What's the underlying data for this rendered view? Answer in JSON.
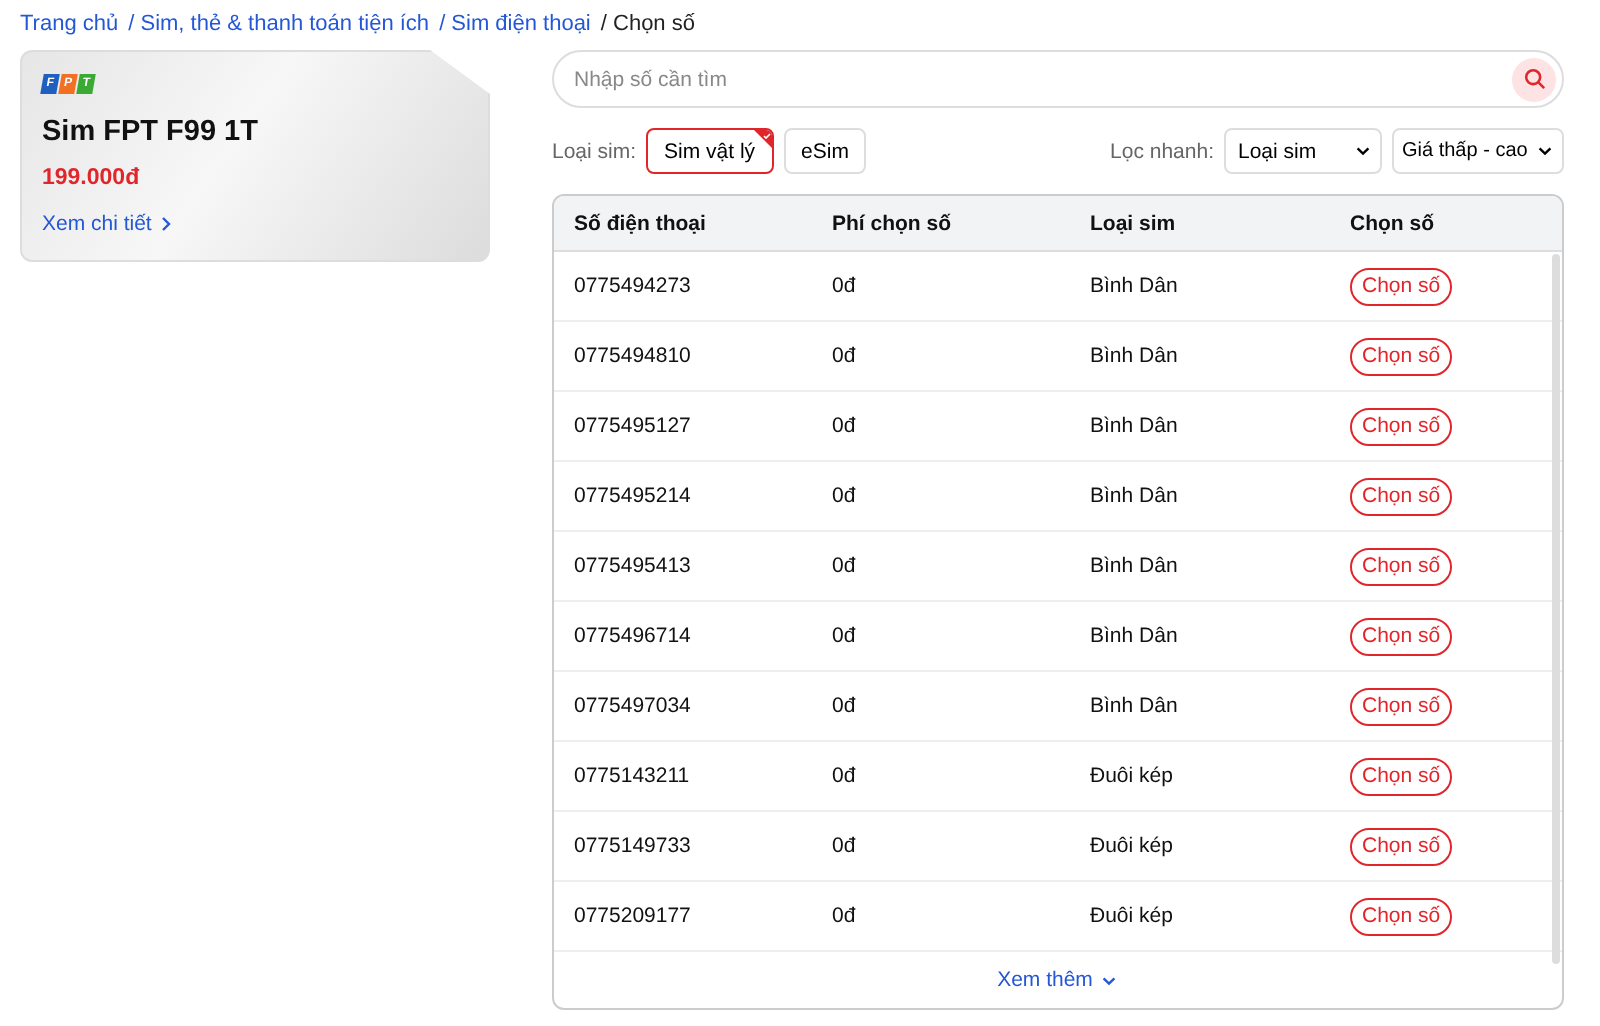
{
  "breadcrumb": [
    {
      "label": "Trang chủ",
      "current": false
    },
    {
      "label": "/ Sim, thẻ & thanh toán tiện ích",
      "current": false
    },
    {
      "label": "/ Sim điện thoại",
      "current": false
    },
    {
      "label": "/ Chọn số",
      "current": true
    }
  ],
  "product": {
    "logo": [
      {
        "letter": "F",
        "color": "#1f5fbf"
      },
      {
        "letter": "P",
        "color": "#f27024"
      },
      {
        "letter": "T",
        "color": "#3aaa35"
      }
    ],
    "name": "Sim FPT F99 1T",
    "price": "199.000đ",
    "link": "Xem chi tiết"
  },
  "search": {
    "placeholder": "Nhập số cần tìm"
  },
  "sim_type": {
    "label": "Loại sim:",
    "options": [
      {
        "label": "Sim vật lý",
        "selected": true
      },
      {
        "label": "eSim",
        "selected": false
      }
    ]
  },
  "quick_filter": {
    "label": "Lọc nhanh:",
    "dropdowns": [
      "Loại sim",
      "Giá thấp - cao"
    ]
  },
  "table": {
    "columns": [
      "Số điện thoại",
      "Phí chọn số",
      "Loại sim",
      "Chọn số"
    ],
    "rows": [
      {
        "number": "0775494273",
        "fee": "0đ",
        "type": "Bình Dân",
        "action": "Chọn số"
      },
      {
        "number": "0775494810",
        "fee": "0đ",
        "type": "Bình Dân",
        "action": "Chọn số"
      },
      {
        "number": "0775495127",
        "fee": "0đ",
        "type": "Bình Dân",
        "action": "Chọn số"
      },
      {
        "number": "0775495214",
        "fee": "0đ",
        "type": "Bình Dân",
        "action": "Chọn số"
      },
      {
        "number": "0775495413",
        "fee": "0đ",
        "type": "Bình Dân",
        "action": "Chọn số"
      },
      {
        "number": "0775496714",
        "fee": "0đ",
        "type": "Bình Dân",
        "action": "Chọn số"
      },
      {
        "number": "0775497034",
        "fee": "0đ",
        "type": "Bình Dân",
        "action": "Chọn số"
      },
      {
        "number": "0775143211",
        "fee": "0đ",
        "type": "Đuôi kép",
        "action": "Chọn số"
      },
      {
        "number": "0775149733",
        "fee": "0đ",
        "type": "Đuôi kép",
        "action": "Chọn số"
      },
      {
        "number": "0775209177",
        "fee": "0đ",
        "type": "Đuôi kép",
        "action": "Chọn số"
      }
    ],
    "more": "Xem thêm"
  }
}
